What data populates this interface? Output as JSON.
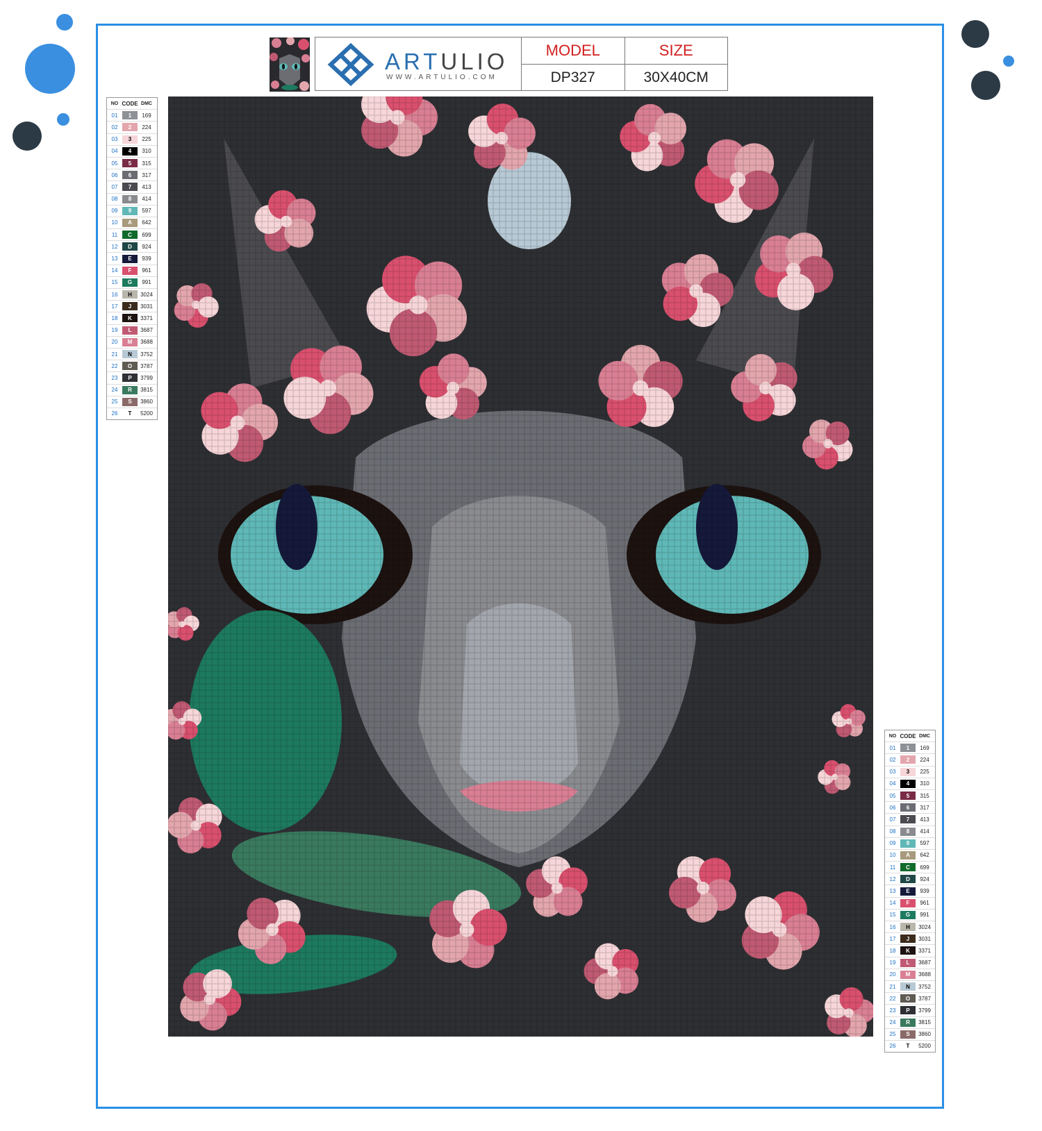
{
  "brand": {
    "name_prefix": "ART",
    "name_suffix": "ULIO",
    "website": "WWW.ARTULIO.COM",
    "accent": "#2a6fb0"
  },
  "header": {
    "model_label": "MODEL",
    "model_value": "DP327",
    "size_label": "SIZE",
    "size_value": "30X40CM"
  },
  "legend": {
    "col_no": "NO",
    "col_code": "CODE",
    "col_dmc": "DMC",
    "rows": [
      {
        "no": "01",
        "code": "1",
        "dmc": "169",
        "color": "#8e9196"
      },
      {
        "no": "02",
        "code": "2",
        "dmc": "224",
        "color": "#e3a6ad"
      },
      {
        "no": "03",
        "code": "3",
        "dmc": "225",
        "color": "#f6d6d8"
      },
      {
        "no": "04",
        "code": "4",
        "dmc": "310",
        "color": "#000000"
      },
      {
        "no": "05",
        "code": "5",
        "dmc": "315",
        "color": "#7a2b45"
      },
      {
        "no": "06",
        "code": "6",
        "dmc": "317",
        "color": "#6b6d73"
      },
      {
        "no": "07",
        "code": "7",
        "dmc": "413",
        "color": "#4a4a4f"
      },
      {
        "no": "08",
        "code": "8",
        "dmc": "414",
        "color": "#8a8b8f"
      },
      {
        "no": "09",
        "code": "9",
        "dmc": "597",
        "color": "#5fb8b7"
      },
      {
        "no": "10",
        "code": "A",
        "dmc": "642",
        "color": "#a89a7c"
      },
      {
        "no": "11",
        "code": "C",
        "dmc": "699",
        "color": "#0f6b2c"
      },
      {
        "no": "12",
        "code": "D",
        "dmc": "924",
        "color": "#1f4746"
      },
      {
        "no": "13",
        "code": "E",
        "dmc": "939",
        "color": "#15193a"
      },
      {
        "no": "14",
        "code": "F",
        "dmc": "961",
        "color": "#d9506e"
      },
      {
        "no": "15",
        "code": "G",
        "dmc": "991",
        "color": "#1d7a5e"
      },
      {
        "no": "16",
        "code": "H",
        "dmc": "3024",
        "color": "#b9b6ac"
      },
      {
        "no": "17",
        "code": "J",
        "dmc": "3031",
        "color": "#3b2b1c"
      },
      {
        "no": "18",
        "code": "K",
        "dmc": "3371",
        "color": "#1c1210"
      },
      {
        "no": "19",
        "code": "L",
        "dmc": "3687",
        "color": "#c05a73"
      },
      {
        "no": "20",
        "code": "M",
        "dmc": "3688",
        "color": "#d97f94"
      },
      {
        "no": "21",
        "code": "N",
        "dmc": "3752",
        "color": "#b7c9d4"
      },
      {
        "no": "22",
        "code": "O",
        "dmc": "3787",
        "color": "#5f5a52"
      },
      {
        "no": "23",
        "code": "P",
        "dmc": "3799",
        "color": "#2f3034"
      },
      {
        "no": "24",
        "code": "R",
        "dmc": "3815",
        "color": "#3a7a5f"
      },
      {
        "no": "25",
        "code": "S",
        "dmc": "3860",
        "color": "#8a6a68"
      },
      {
        "no": "26",
        "code": "T",
        "dmc": "5200",
        "color": "#ffffff"
      }
    ]
  },
  "theme": {
    "frame_color": "#2a8fe6",
    "dot_light": "#3a8fe0",
    "dot_dark": "#2c3a46"
  }
}
